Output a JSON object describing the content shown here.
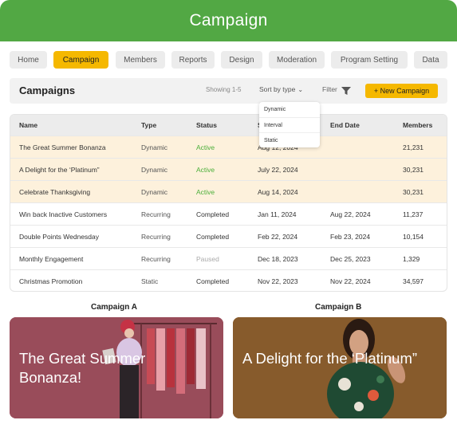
{
  "header": {
    "title": "Campaign"
  },
  "tabs": [
    {
      "label": "Home",
      "active": false
    },
    {
      "label": "Campaign",
      "active": true
    },
    {
      "label": "Members",
      "active": false
    },
    {
      "label": "Reports",
      "active": false
    },
    {
      "label": "Design",
      "active": false
    },
    {
      "label": "Moderation",
      "active": false
    },
    {
      "label": "Program Setting",
      "active": false
    },
    {
      "label": "Data",
      "active": false
    }
  ],
  "toolbar": {
    "title": "Campaigns",
    "showing": "Showing 1-5",
    "sort_label": "Sort by type",
    "filter_label": "Filter",
    "new_button": "+ New Campaign"
  },
  "sort_options": [
    "Dynamic",
    "Interval",
    "Static"
  ],
  "table": {
    "columns": [
      "Name",
      "Type",
      "Status",
      "S",
      "End Date",
      "Members"
    ],
    "rows": [
      {
        "name": "The Great Summer Bonanza",
        "type": "Dynamic",
        "status": "Active",
        "start": "Aug 12, 2024",
        "end": "",
        "members": "21,231"
      },
      {
        "name": "A Delight for the ‘Platinum”",
        "type": "Dynamic",
        "status": "Active",
        "start": "July 22, 2024",
        "end": "",
        "members": "30,231"
      },
      {
        "name": "Celebrate Thanksgiving",
        "type": "Dynamic",
        "status": "Active",
        "start": "Aug 14, 2024",
        "end": "",
        "members": "30,231"
      },
      {
        "name": "Win back Inactive Customers",
        "type": "Recurring",
        "status": "Completed",
        "start": "Jan 11, 2024",
        "end": "Aug 22, 2024",
        "members": "11,237"
      },
      {
        "name": "Double Points Wednesday",
        "type": "Recurring",
        "status": "Completed",
        "start": "Feb 22, 2024",
        "end": "Feb 23, 2024",
        "members": "10,154"
      },
      {
        "name": "Monthly Engagement",
        "type": "Recurring",
        "status": "Paused",
        "start": "Dec 18, 2023",
        "end": "Dec 25, 2023",
        "members": "1,329"
      },
      {
        "name": "Christmas Promotion",
        "type": "Static",
        "status": "Completed",
        "start": "Nov 22, 2023",
        "end": "Nov 22, 2024",
        "members": "34,597"
      }
    ]
  },
  "cards": [
    {
      "caption": "Campaign A",
      "text": "The Great Summer Bonanza!",
      "color": "#a15462"
    },
    {
      "caption": "Campaign B",
      "text": "A Delight for the ‘Platinum”",
      "color": "#8f6230"
    }
  ],
  "colors": {
    "brand": "#52a844",
    "accent": "#f5b800",
    "highlight_row": "#fdf1dc",
    "active_status": "#4caf3a"
  }
}
